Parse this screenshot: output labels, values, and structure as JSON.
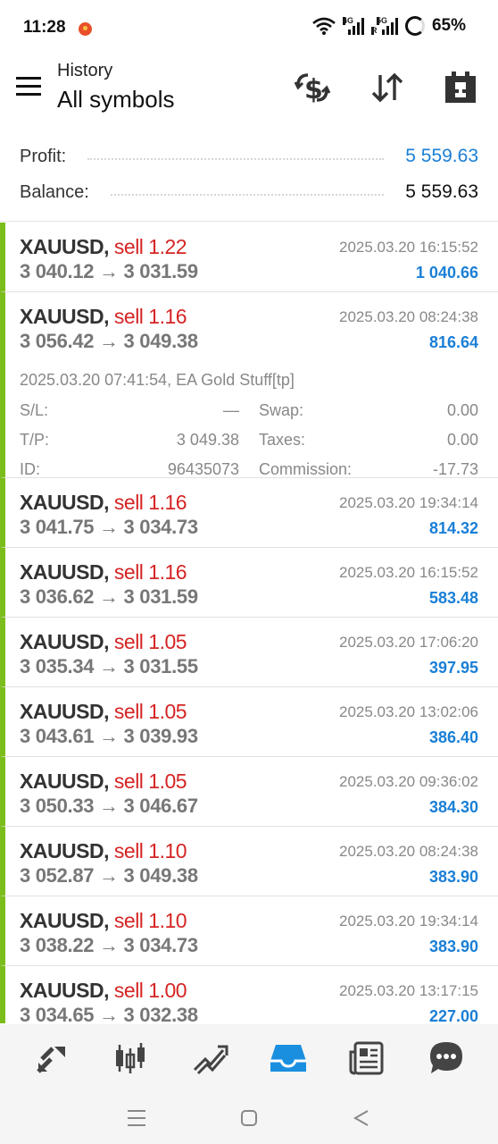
{
  "status": {
    "time": "11:28",
    "net1": "4G",
    "net2": "5G",
    "roaming": "R",
    "battery": "65%"
  },
  "header": {
    "subtitle": "History",
    "title": "All symbols"
  },
  "summary": {
    "profit_label": "Profit:",
    "profit_value": "5 559.63",
    "balance_label": "Balance:",
    "balance_value": "5 559.63"
  },
  "colors": {
    "accent": "#1a7fd6",
    "sell": "#d62424",
    "bar": "#7bbd1b"
  },
  "deals": [
    {
      "symbol": "XAUUSD,",
      "dir": "sell 1.22",
      "prices": "3 040.12 → 3 031.59",
      "time": "2025.03.20 16:15:52",
      "profit": "1 040.66"
    },
    {
      "symbol": "XAUUSD,",
      "dir": "sell 1.16",
      "prices": "3 056.42 → 3 049.38",
      "time": "2025.03.20 08:24:38",
      "profit": "816.64",
      "info": "2025.03.20 07:41:54, EA Gold Stuff[tp]",
      "sl_label": "S/L:",
      "sl": "—",
      "swap_label": "Swap:",
      "swap": "0.00",
      "tp_label": "T/P:",
      "tp": "3 049.38",
      "taxes_label": "Taxes:",
      "taxes": "0.00",
      "id_label": "ID:",
      "id": "96435073",
      "commission_label": "Commission:",
      "commission": "-17.73"
    },
    {
      "symbol": "XAUUSD,",
      "dir": "sell 1.16",
      "prices": "3 041.75 → 3 034.73",
      "time": "2025.03.20 19:34:14",
      "profit": "814.32"
    },
    {
      "symbol": "XAUUSD,",
      "dir": "sell 1.16",
      "prices": "3 036.62 → 3 031.59",
      "time": "2025.03.20 16:15:52",
      "profit": "583.48"
    },
    {
      "symbol": "XAUUSD,",
      "dir": "sell 1.05",
      "prices": "3 035.34 → 3 031.55",
      "time": "2025.03.20 17:06:20",
      "profit": "397.95"
    },
    {
      "symbol": "XAUUSD,",
      "dir": "sell 1.05",
      "prices": "3 043.61 → 3 039.93",
      "time": "2025.03.20 13:02:06",
      "profit": "386.40"
    },
    {
      "symbol": "XAUUSD,",
      "dir": "sell 1.05",
      "prices": "3 050.33 → 3 046.67",
      "time": "2025.03.20 09:36:02",
      "profit": "384.30"
    },
    {
      "symbol": "XAUUSD,",
      "dir": "sell 1.10",
      "prices": "3 052.87 → 3 049.38",
      "time": "2025.03.20 08:24:38",
      "profit": "383.90"
    },
    {
      "symbol": "XAUUSD,",
      "dir": "sell 1.10",
      "prices": "3 038.22 → 3 034.73",
      "time": "2025.03.20 19:34:14",
      "profit": "383.90"
    },
    {
      "symbol": "XAUUSD,",
      "dir": "sell 1.00",
      "prices": "3 034.65 → 3 032.38",
      "time": "2025.03.20 13:17:15",
      "profit": "227.00"
    }
  ],
  "bottom_nav": [
    "quotes-icon",
    "chart-icon",
    "trade-icon",
    "history-icon",
    "news-icon",
    "messages-icon"
  ],
  "active_tab": "history-icon"
}
